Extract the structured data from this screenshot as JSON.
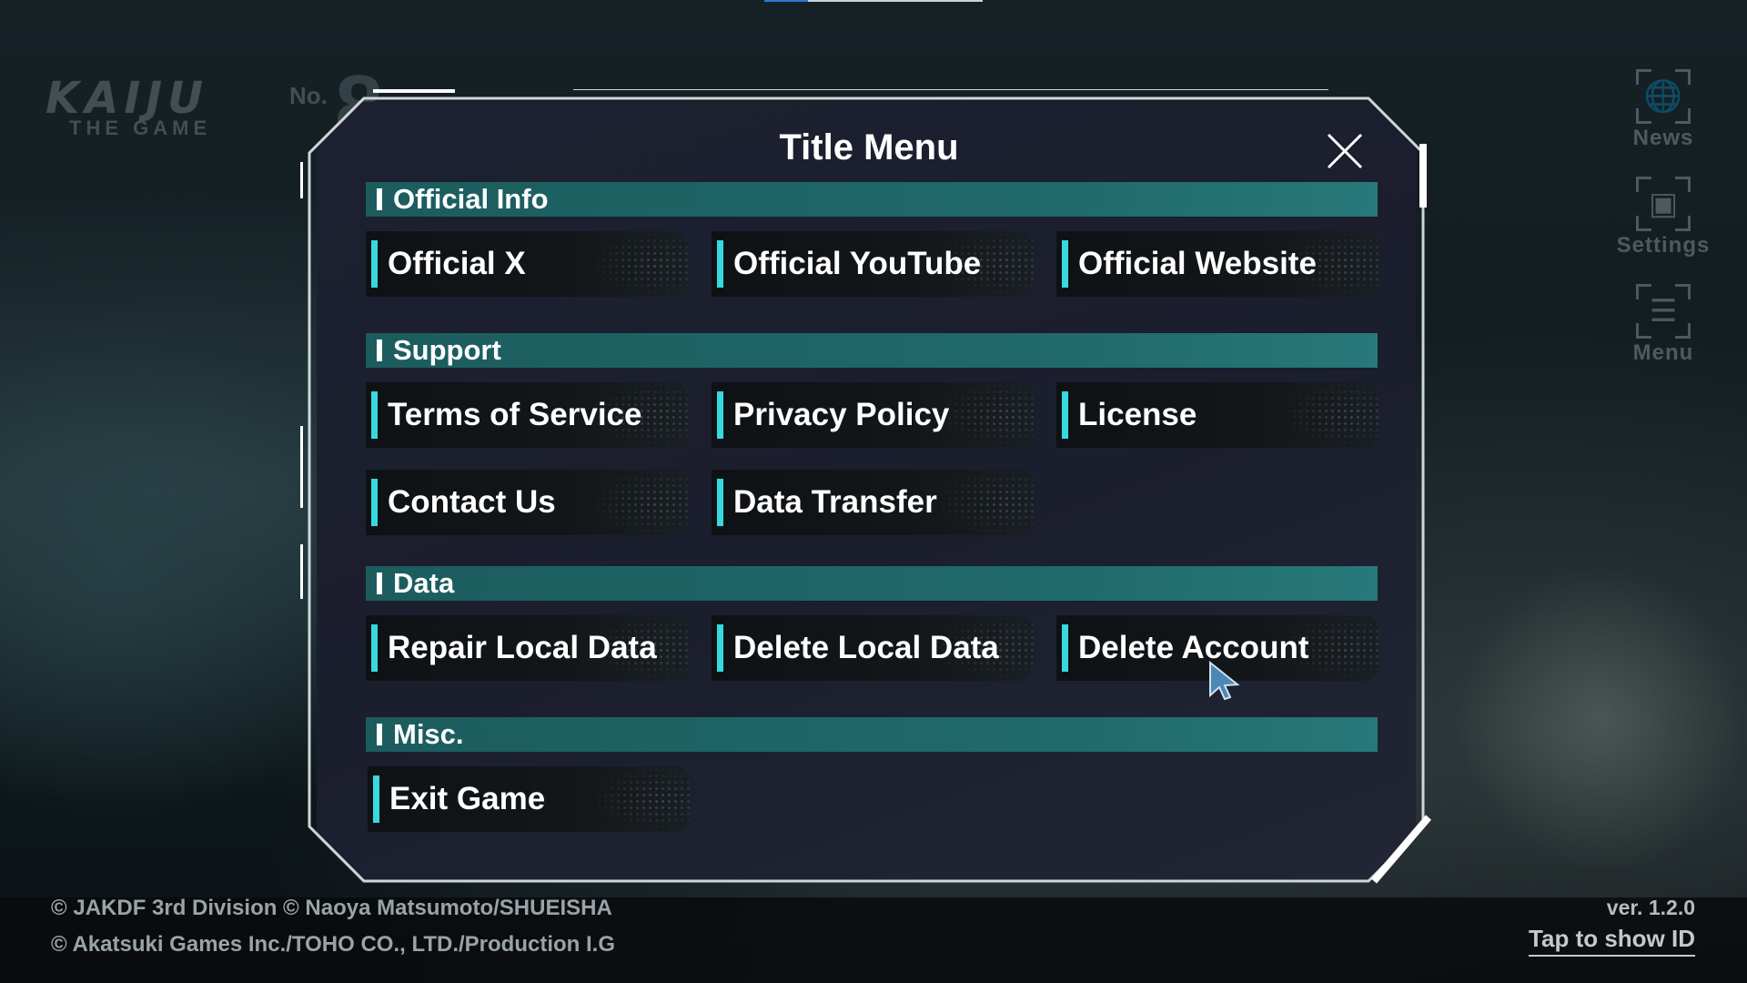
{
  "logo": {
    "main": "KAIJU",
    "no": "No.",
    "number": "8",
    "sub": "THE GAME"
  },
  "side_buttons": [
    {
      "label": "News",
      "icon": "globe-icon",
      "glyph": "🌐"
    },
    {
      "label": "Settings",
      "icon": "settings-icon",
      "glyph": "▣"
    },
    {
      "label": "Menu",
      "icon": "menu-icon",
      "glyph": "☰"
    }
  ],
  "panel": {
    "title": "Title Menu",
    "close_icon": "close-icon",
    "sections": [
      {
        "title": "Official Info",
        "buttons": [
          "Official X",
          "Official YouTube",
          "Official Website"
        ]
      },
      {
        "title": "Support",
        "buttons": [
          "Terms of Service",
          "Privacy Policy",
          "License",
          "Contact Us",
          "Data Transfer"
        ]
      },
      {
        "title": "Data",
        "buttons": [
          "Repair Local Data",
          "Delete Local Data",
          "Delete Account"
        ]
      },
      {
        "title": "Misc.",
        "buttons": [
          "Exit Game"
        ]
      }
    ]
  },
  "footer": {
    "copyright_line1": "© JAKDF 3rd Division © Naoya Matsumoto/SHUEISHA",
    "copyright_line2": "© Akatsuki Games Inc./TOHO CO., LTD./Production I.G",
    "version": "ver. 1.2.0",
    "tap_to_show_id": "Tap to show ID"
  },
  "colors": {
    "accent": "#39d8e0",
    "section_bar": "#206a6c",
    "panel_bg": "#1d2030"
  }
}
